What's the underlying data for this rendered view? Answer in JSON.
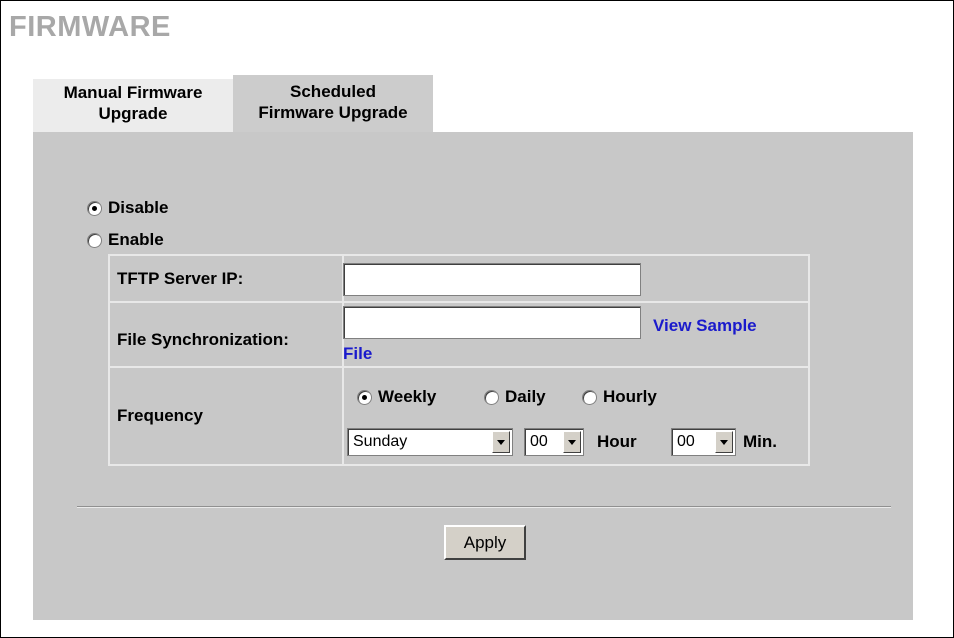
{
  "page": {
    "title": "FIRMWARE"
  },
  "tabs": [
    {
      "line1": "Manual Firmware",
      "line2": "Upgrade",
      "active": false
    },
    {
      "line1": "Scheduled",
      "line2": "Firmware Upgrade",
      "active": true
    }
  ],
  "schedule": {
    "disable_label": "Disable",
    "enable_label": "Enable",
    "selected": "Disable"
  },
  "tftp": {
    "label": "TFTP Server IP:",
    "value": ""
  },
  "file_sync": {
    "label": "File Synchronization:",
    "value": "",
    "link_line1": "View Sample",
    "link_line2": "File"
  },
  "frequency": {
    "label": "Frequency",
    "options": [
      "Weekly",
      "Daily",
      "Hourly"
    ],
    "selected": "Weekly",
    "day": "Sunday",
    "hour": "00",
    "hour_label": "Hour",
    "minute": "00",
    "minute_label": "Min."
  },
  "actions": {
    "apply_label": "Apply"
  }
}
